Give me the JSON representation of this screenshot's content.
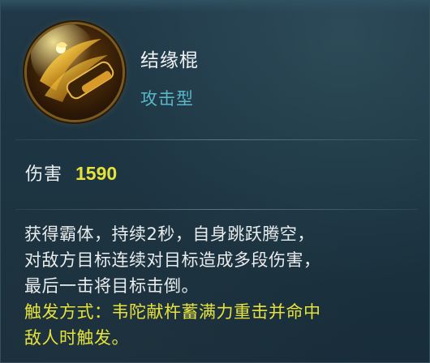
{
  "item": {
    "name": "结缘棍",
    "type": "攻击型",
    "icon": "golden-staff-icon"
  },
  "stats": {
    "damage_label": "伤害",
    "damage_value": "1590"
  },
  "description": {
    "lines": [
      "获得霸体，持续2秒，自身跳跃腾空，",
      "对敌方目标连续对目标造成多段伤害，",
      "最后一击将目标击倒。"
    ],
    "trigger_lines": [
      "触发方式：韦陀献杵蓄满力重击并命中",
      "敌人时触发。"
    ]
  },
  "colors": {
    "panel_bg": "#1c3442",
    "name": "#f2f4f5",
    "type": "#58b6c8",
    "damage_value": "#e6e23a",
    "trigger": "#e6e23a"
  }
}
